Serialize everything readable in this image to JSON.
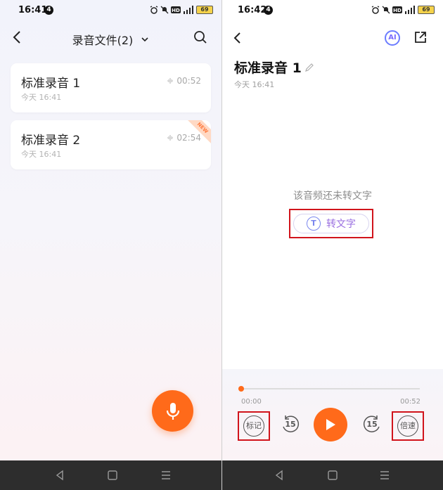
{
  "left_screen": {
    "status": {
      "time": "16:41",
      "notif_count": "4",
      "battery": "69"
    },
    "header": {
      "title": "录音文件(2)"
    },
    "recordings": [
      {
        "name": "标准录音 1",
        "date": "今天 16:41",
        "duration": "00:52",
        "is_new": false
      },
      {
        "name": "标准录音 2",
        "date": "今天 16:41",
        "duration": "02:54",
        "is_new": true,
        "new_tag": "NEW"
      }
    ]
  },
  "right_screen": {
    "status": {
      "time": "16:42",
      "notif_count": "4",
      "battery": "69"
    },
    "header": {
      "ai_label": "AI"
    },
    "recording": {
      "title": "标准录音 1",
      "date": "今天 16:41"
    },
    "transcript": {
      "empty_text": "该音频还未转文字",
      "convert_label": "转文字",
      "icon_letter": "T"
    },
    "player": {
      "current_time": "00:00",
      "total_time": "00:52",
      "progress": 0,
      "mark_label": "标记",
      "skip_back": "15",
      "skip_forward": "15",
      "speed_label": "倍速"
    }
  },
  "colors": {
    "accent": "#ff6a1a",
    "highlight_box": "#d1141c",
    "ai_blue": "#6b7cff"
  }
}
